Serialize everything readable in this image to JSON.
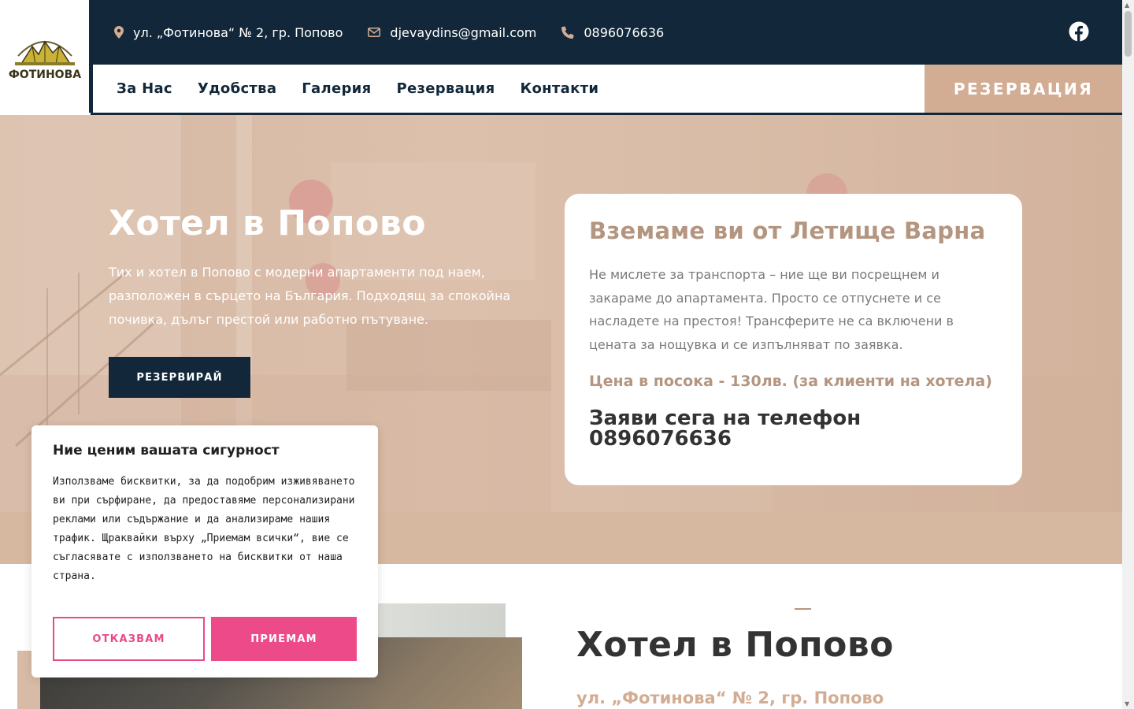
{
  "brand": {
    "logo_text": "ФОТИНОВА"
  },
  "topbar": {
    "address": "ул. „Фотинова“ № 2, гр. Попово",
    "email": "djevaydins@gmail.com",
    "phone": "0896076636"
  },
  "nav": {
    "items": [
      "За Нас",
      "Удобства",
      "Галерия",
      "Резервация",
      "Контакти"
    ],
    "cta": "РЕЗЕРВАЦИЯ"
  },
  "hero": {
    "title": "Хотел в Попово",
    "text": "Тих и хотел в Попово с модерни апартаменти под наем, разположен в сърцето на България. Подходящ за спокойна почивка, дълъг престой или работно пътуване.",
    "button": "РЕЗЕРВИРАЙ"
  },
  "card": {
    "title": "Вземаме ви от Летище Варна",
    "text": "Не мислете за транспорта – ние ще ви посрещнем и закараме до апартамента. Просто се отпуснете и се насладете на престоя! Трансферите не са включени в цената за нощувка и се изпълняват по заявка.",
    "price": "Цена в посока - 130лв. (за клиенти на хотела)",
    "call": "Заяви сега на телефон 0896076636"
  },
  "section": {
    "title": "Хотел в Попово",
    "subtitle": "ул. „Фотинова“ № 2, гр. Попово"
  },
  "cookie": {
    "title": "Ние ценим вашата сигурност",
    "text": "Използваме бисквитки, за да подобрим изживяването ви при сърфиране, да предоставяме персонализирани реклами или съдържание и да анализираме нашия трафик. Щраквайки върху „Приемам всички“, вие се съгласявате с използването на бисквитки от наша страна.",
    "reject": "ОТКАЗВАМ",
    "accept": "ПРИЕМАМ"
  },
  "colors": {
    "navy": "#12283a",
    "tan": "#d2ad94",
    "taupe": "#b49580",
    "pink": "#ec4a89"
  }
}
